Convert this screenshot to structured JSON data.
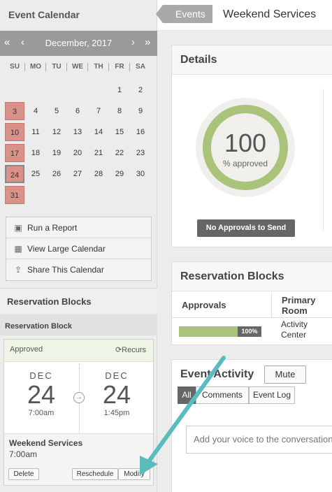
{
  "sidebar": {
    "title": "Event Calendar",
    "calendar": {
      "month_label": "December, 2017",
      "nav": {
        "first": "«",
        "prev": "‹",
        "next": "›",
        "last": "»"
      },
      "weekdays": [
        "SU",
        "MO",
        "TU",
        "WE",
        "TH",
        "FR",
        "SA"
      ],
      "weeks": [
        [
          "",
          "",
          "",
          "",
          "",
          "1",
          "2"
        ],
        [
          "3",
          "4",
          "5",
          "6",
          "7",
          "8",
          "9"
        ],
        [
          "10",
          "11",
          "12",
          "13",
          "14",
          "15",
          "16"
        ],
        [
          "17",
          "18",
          "19",
          "20",
          "21",
          "22",
          "23"
        ],
        [
          "24",
          "25",
          "26",
          "27",
          "28",
          "29",
          "30"
        ],
        [
          "31",
          "",
          "",
          "",
          "",
          "",
          ""
        ]
      ],
      "selected_day": "24",
      "highlight_color": "#d9918a"
    },
    "actions": [
      {
        "label": "Run a Report",
        "icon": "report-icon",
        "glyph": "▣"
      },
      {
        "label": "View Large Calendar",
        "icon": "calendar-icon",
        "glyph": "▦"
      },
      {
        "label": "Share This Calendar",
        "icon": "share-icon",
        "glyph": "⇪"
      }
    ],
    "reservation_blocks_heading": "Reservation Blocks",
    "reservation_block": {
      "subheading": "Reservation Block",
      "status": "Approved",
      "recurs_label": "Recurs",
      "start": {
        "month": "DEC",
        "day": "24",
        "time": "7:00am"
      },
      "end": {
        "month": "DEC",
        "day": "24",
        "time": "1:45pm"
      },
      "event_name": "Weekend Services",
      "event_time": "7:00am",
      "buttons": {
        "delete": "Delete",
        "reschedule": "Reschedule",
        "modify": "Modify"
      }
    }
  },
  "header": {
    "breadcrumb": "Events",
    "title": "Weekend Services"
  },
  "details": {
    "title": "Details",
    "percent": "100",
    "percent_label": "% approved",
    "approved_fraction": 1.0,
    "no_approvals_label": "No Approvals to Send",
    "accent_color": "#a9c47a"
  },
  "reservation_blocks": {
    "title": "Reservation Blocks",
    "columns": [
      "Approvals",
      "Primary Room"
    ],
    "rows": [
      {
        "approval_pct": "100%",
        "approval_fraction": 1.0,
        "room": "Activity Center"
      }
    ]
  },
  "event_activity": {
    "title": "Event Activity",
    "mute_label": "Mute",
    "tabs": [
      "All",
      "Comments",
      "Event Log"
    ],
    "active_tab": "All",
    "comment_placeholder": "Add your voice to the conversation"
  },
  "annotation": {
    "arrow_color": "#5bbcbf"
  }
}
